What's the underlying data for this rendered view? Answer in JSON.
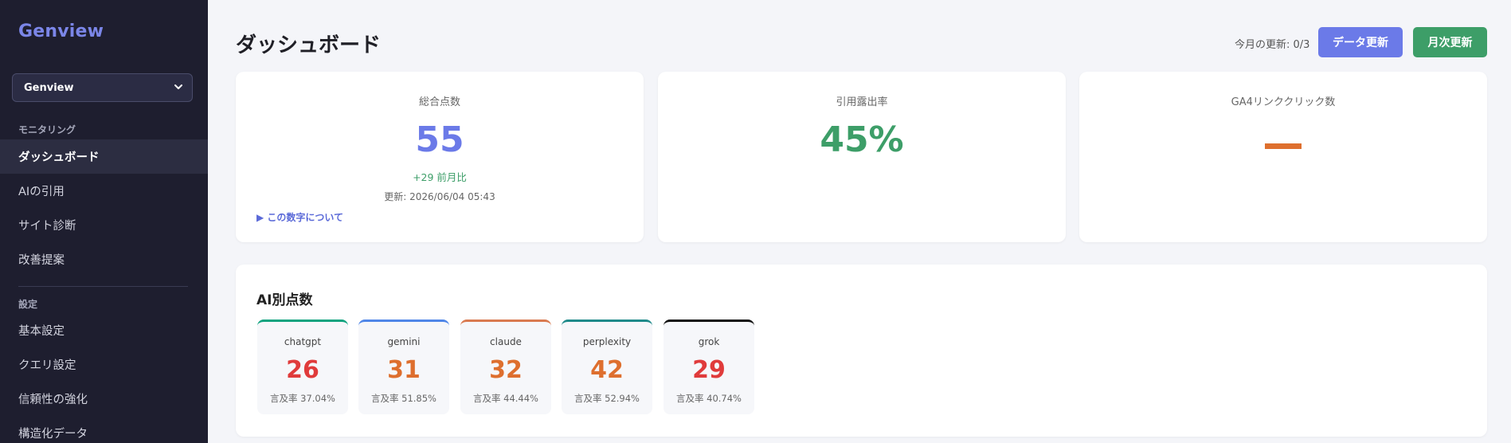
{
  "sidebar": {
    "brand": "Genview",
    "project": "Genview",
    "sections": [
      {
        "label": "モニタリング",
        "items": [
          "ダッシュボード",
          "AIの引用",
          "サイト診断",
          "改善提案"
        ]
      },
      {
        "label": "設定",
        "items": [
          "基本設定",
          "クエリ設定",
          "信頼性の強化",
          "構造化データ"
        ]
      }
    ]
  },
  "header": {
    "title": "ダッシュボード",
    "update_count": "今月の更新: 0/3",
    "refresh_button": "データ更新",
    "monthly_button": "月次更新"
  },
  "metrics": [
    {
      "label": "総合点数",
      "value": "55",
      "delta": "+29 前月比",
      "updated": "更新: 2026/06/04 05:43",
      "link": "▶ この数字について",
      "color": "#6b7ae8"
    },
    {
      "label": "引用露出率",
      "value": "45%",
      "color": "#3d9e68"
    },
    {
      "label": "GA4リンククリック数",
      "value": "",
      "color": "#de6f2e"
    }
  ],
  "ai_section": {
    "title": "AI別点数",
    "items": [
      {
        "name": "chatgpt",
        "score": "26",
        "rate": "言及率 37.04%",
        "accent": "#10a37f",
        "score_color": "#e03b3b"
      },
      {
        "name": "gemini",
        "score": "31",
        "rate": "言及率 51.85%",
        "accent": "#4f86e8",
        "score_color": "#de6f2e"
      },
      {
        "name": "claude",
        "score": "32",
        "rate": "言及率 44.44%",
        "accent": "#d97a50",
        "score_color": "#de6f2e"
      },
      {
        "name": "perplexity",
        "score": "42",
        "rate": "言及率 52.94%",
        "accent": "#1f8a8a",
        "score_color": "#de6f2e"
      },
      {
        "name": "grok",
        "score": "29",
        "rate": "言及率 40.74%",
        "accent": "#111111",
        "score_color": "#e03b3b"
      }
    ]
  }
}
